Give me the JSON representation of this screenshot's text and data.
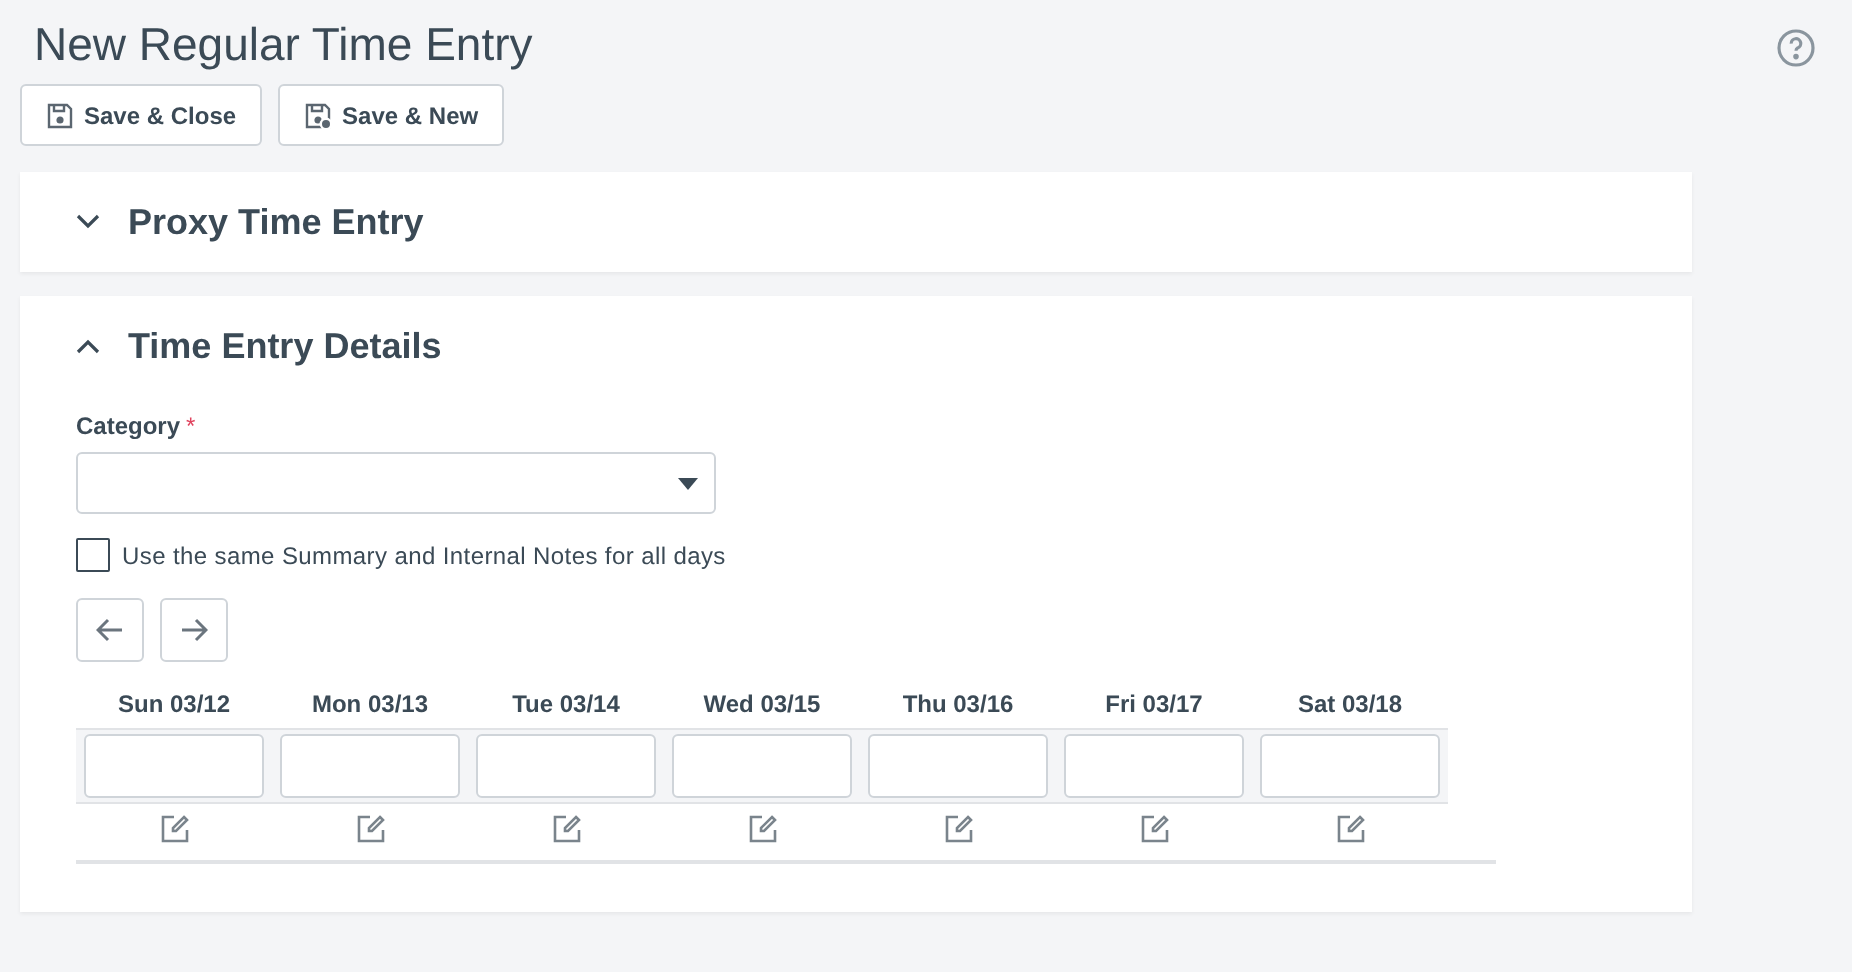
{
  "page_title": "New Regular Time Entry",
  "toolbar": [
    {
      "kind": "save-close",
      "label": "Save & Close"
    },
    {
      "kind": "save-new",
      "label": "Save & New"
    }
  ],
  "sections": [
    {
      "title": "Proxy Time Entry",
      "expanded": false
    },
    {
      "title": "Time Entry Details",
      "expanded": true
    }
  ],
  "category": {
    "label": "Category",
    "required_mark": "*"
  },
  "same_notes": {
    "label": "Use the same Summary and Internal Notes for all days",
    "checked": false
  },
  "days": [
    {
      "label": "Sun 03/12"
    },
    {
      "label": "Mon 03/13"
    },
    {
      "label": "Tue 03/14"
    },
    {
      "label": "Wed 03/15"
    },
    {
      "label": "Thu 03/16"
    },
    {
      "label": "Fri 03/17"
    },
    {
      "label": "Sat 03/18"
    }
  ]
}
